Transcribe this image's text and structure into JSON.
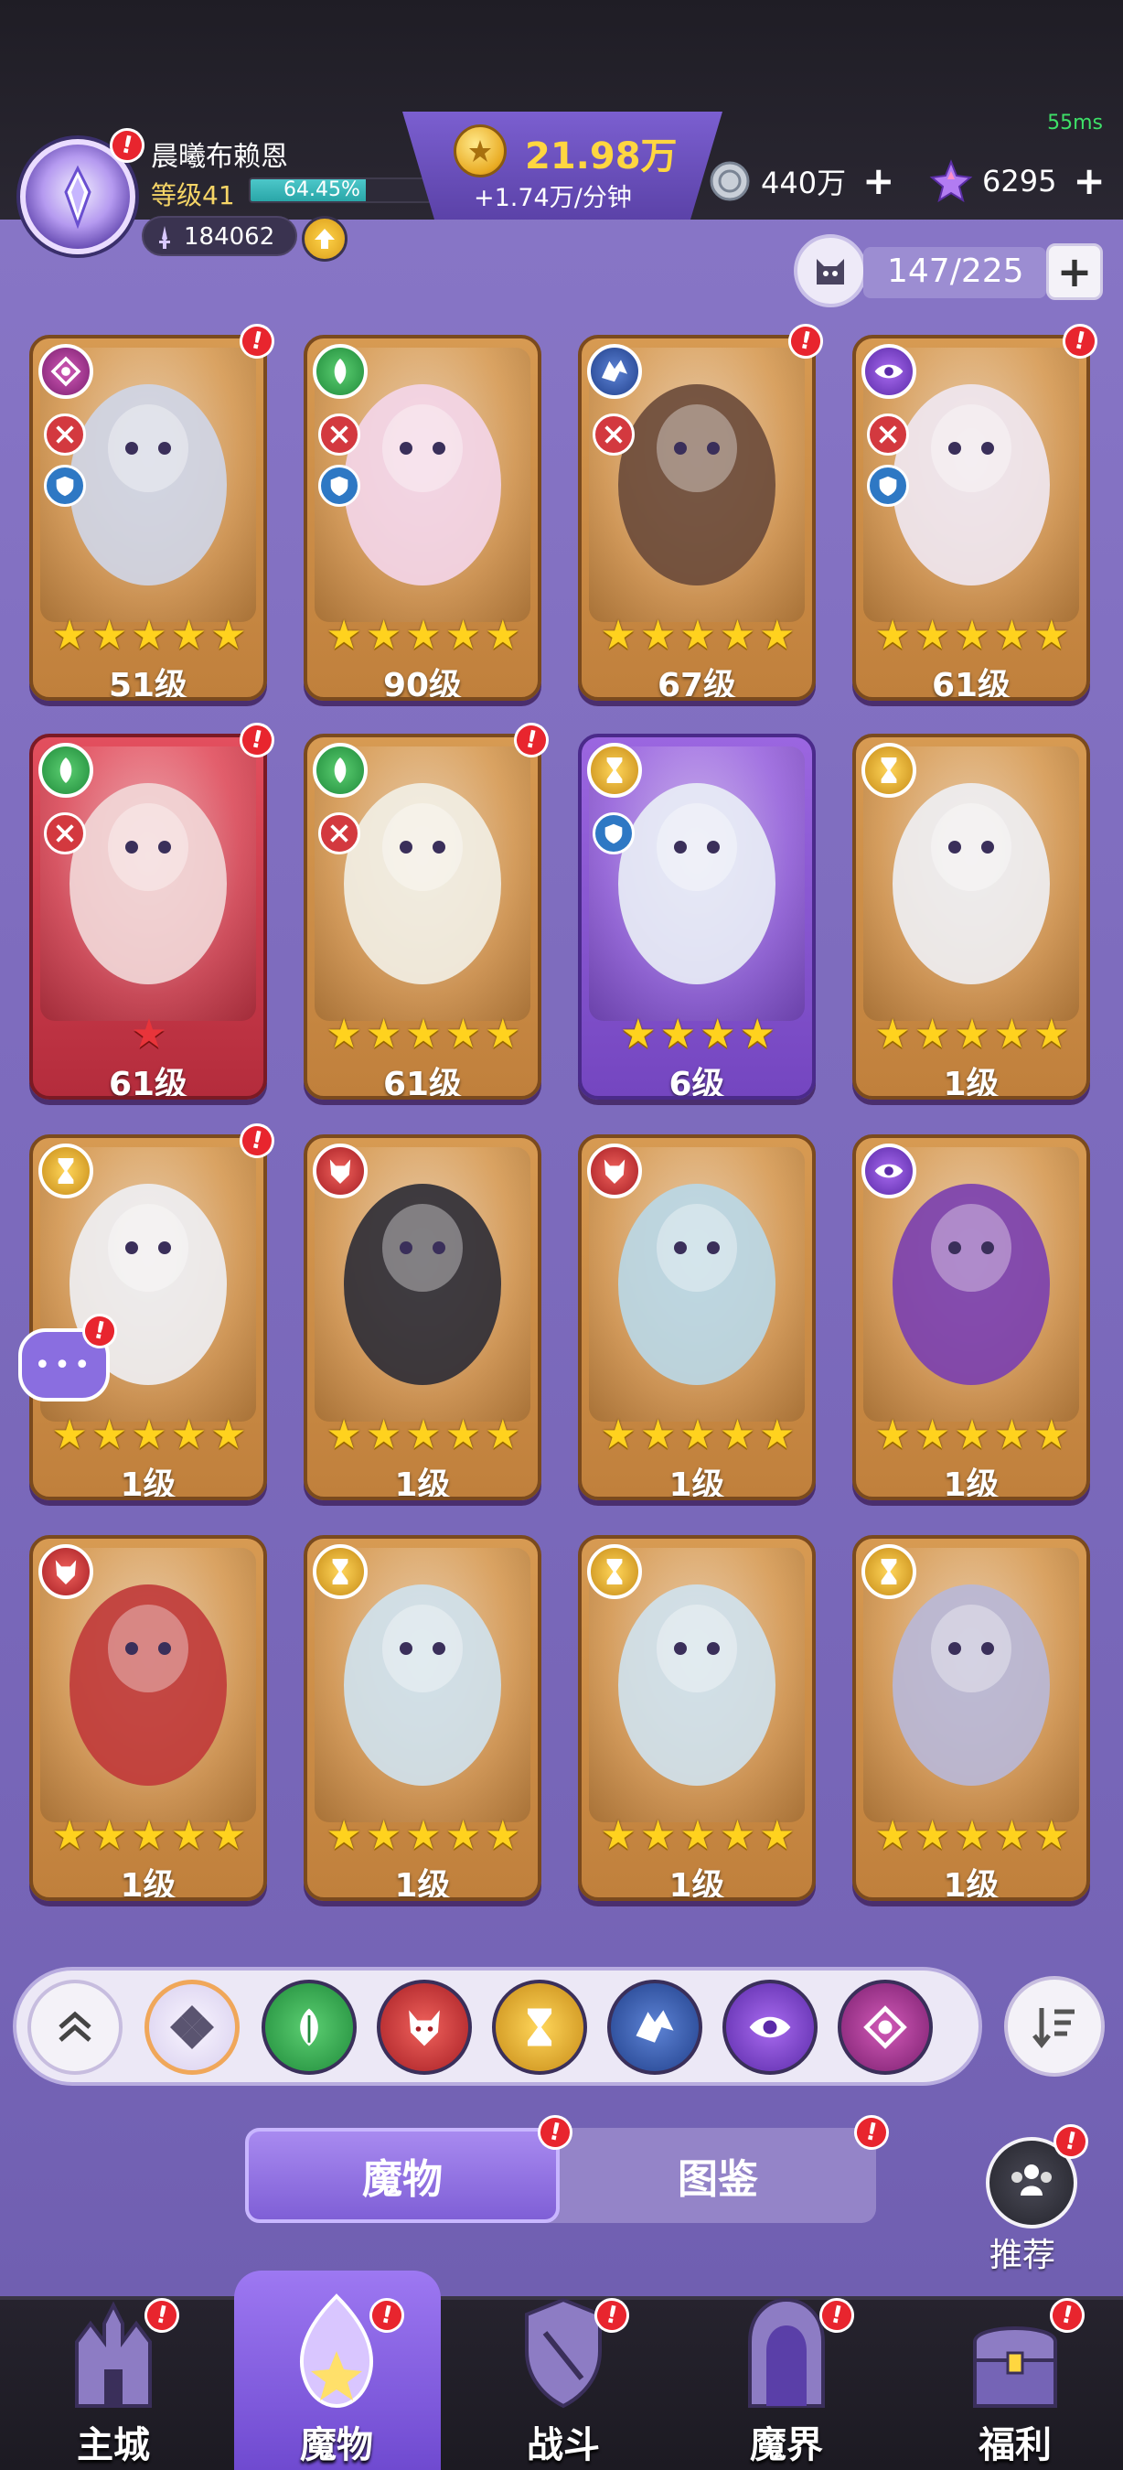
{
  "status": {
    "ping": "55ms"
  },
  "player": {
    "name": "晨曦布赖恩",
    "level": "等级41",
    "exp_text": "64.45%",
    "exp_fraction": 0.6445,
    "power": "184062"
  },
  "currency": {
    "gold": "21.98万",
    "gold_rate": "+1.74万/分钟",
    "silver": "440万",
    "gems": "6295",
    "plus": "+"
  },
  "capacity": {
    "text": "147/225",
    "plus": "+"
  },
  "monsters": [
    {
      "level": "51级",
      "element": "wind",
      "stars": 5,
      "star_color": "gold",
      "badge": true
    },
    {
      "level": "90级",
      "element": "nature",
      "stars": 5,
      "star_color": "gold",
      "badge": false
    },
    {
      "level": "67级",
      "element": "dragon",
      "stars": 5,
      "star_color": "gold",
      "badge": true
    },
    {
      "level": "61级",
      "element": "eye",
      "stars": 5,
      "star_color": "gold",
      "badge": true
    },
    {
      "level": "61级",
      "element": "nature",
      "stars": 1,
      "star_color": "red",
      "badge": true
    },
    {
      "level": "61级",
      "element": "nature",
      "stars": 5,
      "star_color": "gold",
      "badge": true
    },
    {
      "level": "6级",
      "element": "time",
      "stars": 4,
      "star_color": "gold",
      "badge": false
    },
    {
      "level": "1级",
      "element": "time",
      "stars": 5,
      "star_color": "gold",
      "badge": false
    },
    {
      "level": "1级",
      "element": "time",
      "stars": 5,
      "star_color": "gold",
      "badge": true
    },
    {
      "level": "1级",
      "element": "demon",
      "stars": 5,
      "star_color": "gold",
      "badge": false
    },
    {
      "level": "1级",
      "element": "demon",
      "stars": 5,
      "star_color": "gold",
      "badge": false
    },
    {
      "level": "1级",
      "element": "eye",
      "stars": 5,
      "star_color": "gold",
      "badge": false
    },
    {
      "level": "1级",
      "element": "demon",
      "stars": 5,
      "star_color": "gold",
      "badge": false
    },
    {
      "level": "1级",
      "element": "time",
      "stars": 5,
      "star_color": "gold",
      "badge": false
    },
    {
      "level": "1级",
      "element": "time",
      "stars": 5,
      "star_color": "gold",
      "badge": false
    },
    {
      "level": "1级",
      "element": "time",
      "stars": 5,
      "star_color": "gold",
      "badge": false
    }
  ],
  "filters": [
    "collapse-icon",
    "all-elements-icon",
    "nature-icon",
    "demon-icon",
    "time-icon",
    "dragon-icon",
    "eye-icon",
    "wind-icon"
  ],
  "tabs": {
    "monsters": "魔物",
    "codex": "图鉴"
  },
  "recommend": "推荐",
  "nav": [
    "主城",
    "魔物",
    "战斗",
    "魔界",
    "福利"
  ],
  "colors": {
    "accent": "#7f5fd6",
    "gold": "#ffd640",
    "badge": "#e8252e"
  }
}
